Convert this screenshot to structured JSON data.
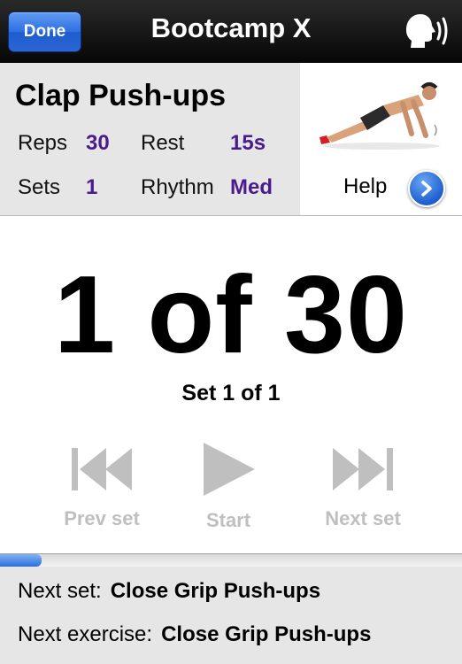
{
  "navbar": {
    "done_label": "Done",
    "title": "Bootcamp X",
    "voice_icon": "speaking-head-icon"
  },
  "exercise": {
    "name": "Clap Push-ups",
    "reps_label": "Reps",
    "reps_value": "30",
    "rest_label": "Rest",
    "rest_value": "15s",
    "sets_label": "Sets",
    "sets_value": "1",
    "rhythm_label": "Rhythm",
    "rhythm_value": "Med",
    "help_label": "Help",
    "help_icon": "chevron-right-icon"
  },
  "counter": {
    "text": "1 of 30",
    "set_text": "Set 1 of 1"
  },
  "controls": {
    "prev_label": "Prev set",
    "start_label": "Start",
    "next_label": "Next set"
  },
  "progress": {
    "fraction": 0.09
  },
  "footer": {
    "next_set_label": "Next set:",
    "next_set_value": "Close Grip Push-ups",
    "next_exercise_label": "Next exercise:",
    "next_exercise_value": "Close Grip Push-ups"
  },
  "colors": {
    "accent_value": "#4a1b8c",
    "disabled_control": "#bfbfbf",
    "done_button": "#2f6fe0"
  }
}
